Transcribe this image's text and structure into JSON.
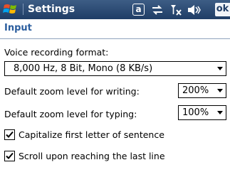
{
  "titlebar": {
    "title": "Settings",
    "start_icon": "windows-flag-icon",
    "input_indicator": "a",
    "ok_label": "ok"
  },
  "section": {
    "title": "Input"
  },
  "voice": {
    "label": "Voice recording format:",
    "value": "8,000 Hz, 8 Bit, Mono (8 KB/s)"
  },
  "zoom_writing": {
    "label": "Default zoom level for writing:",
    "value": "200%"
  },
  "zoom_typing": {
    "label": "Default zoom level for typing:",
    "value": "100%"
  },
  "options": [
    {
      "label": "Capitalize first letter of sentence",
      "checked": true
    },
    {
      "label": "Scroll upon reaching the last line",
      "checked": true
    }
  ]
}
